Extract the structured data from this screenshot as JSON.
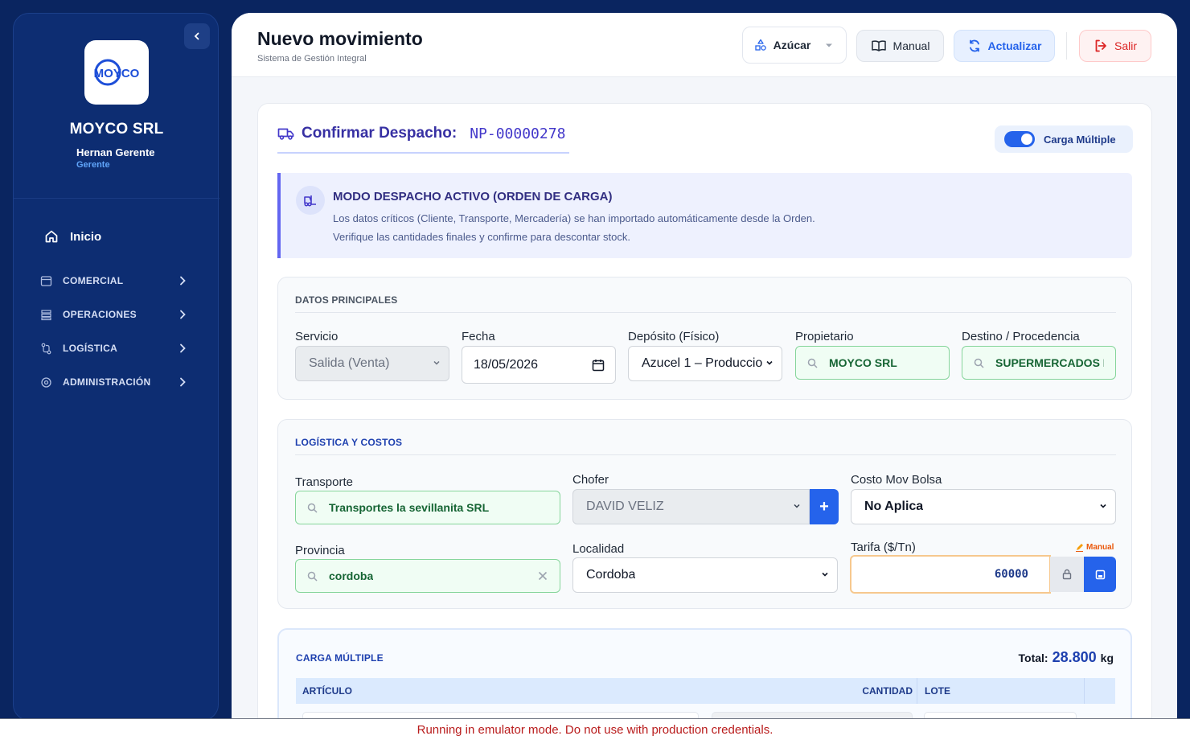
{
  "sidebar": {
    "logo_text": "MOYCO",
    "company": "MOYCO SRL",
    "user_name": "Hernan Gerente",
    "user_role": "Gerente",
    "home_label": "Inicio",
    "items": [
      {
        "label": "COMERCIAL",
        "icon": "store-icon"
      },
      {
        "label": "OPERACIONES",
        "icon": "stack-icon"
      },
      {
        "label": "LOGÍSTICA",
        "icon": "route-icon"
      },
      {
        "label": "ADMINISTRACIÓN",
        "icon": "gear-icon"
      }
    ]
  },
  "header": {
    "title": "Nuevo movimiento",
    "subtitle": "Sistema de Gestión Integral",
    "azucar_label": "Azúcar",
    "manual_label": "Manual",
    "actualizar_label": "Actualizar",
    "salir_label": "Salir"
  },
  "confirm": {
    "label": "Confirmar Despacho:",
    "code": "NP-00000278",
    "toggle_label": "Carga Múltiple",
    "toggle_on": true
  },
  "alert": {
    "title": "MODO DESPACHO ACTIVO (ORDEN DE CARGA)",
    "line1": "Los datos críticos (Cliente, Transporte, Mercadería) se han importado automáticamente desde la Orden.",
    "line2": "Verifique las cantidades finales y confirme para descontar stock."
  },
  "datos": {
    "title": "DATOS PRINCIPALES",
    "servicio_label": "Servicio",
    "servicio_value": "Salida (Venta)",
    "fecha_label": "Fecha",
    "fecha_value": "18/05/2026",
    "deposito_label": "Depósito (Físico)",
    "deposito_value": "Azucel 1 – Produccio",
    "propietario_label": "Propietario",
    "propietario_value": "MOYCO SRL",
    "destino_label": "Destino / Procedencia",
    "destino_value": "SUPERMERCADOS M/"
  },
  "logistica": {
    "title": "LOGÍSTICA Y COSTOS",
    "transporte_label": "Transporte",
    "transporte_value": "Transportes la sevillanita SRL",
    "chofer_label": "Chofer",
    "chofer_value": "DAVID VELIZ",
    "chofer_add": "+",
    "costo_label": "Costo Mov Bolsa",
    "costo_value": "No Aplica",
    "provincia_label": "Provincia",
    "provincia_value": "cordoba",
    "localidad_label": "Localidad",
    "localidad_value": "Cordoba",
    "tarifa_label": "Tarifa ($/Tn)",
    "tarifa_value": "60000",
    "manual_tag": "Manual"
  },
  "carga": {
    "title": "CARGA MÚLTIPLE",
    "total_label": "Total:",
    "total_value": "28.800",
    "total_unit": "kg",
    "col_articulo": "ARTÍCULO",
    "col_cantidad": "CANTIDAD",
    "col_lote": "LOTE"
  },
  "footer": {
    "emulator_notice": "Running in emulator mode. Do not use with production credentials."
  },
  "colors": {
    "sidebar_bg": "#0d2d72",
    "accent": "#2563eb",
    "indigo": "#3730a3",
    "success_green": "#166534",
    "danger": "#dc2626"
  }
}
